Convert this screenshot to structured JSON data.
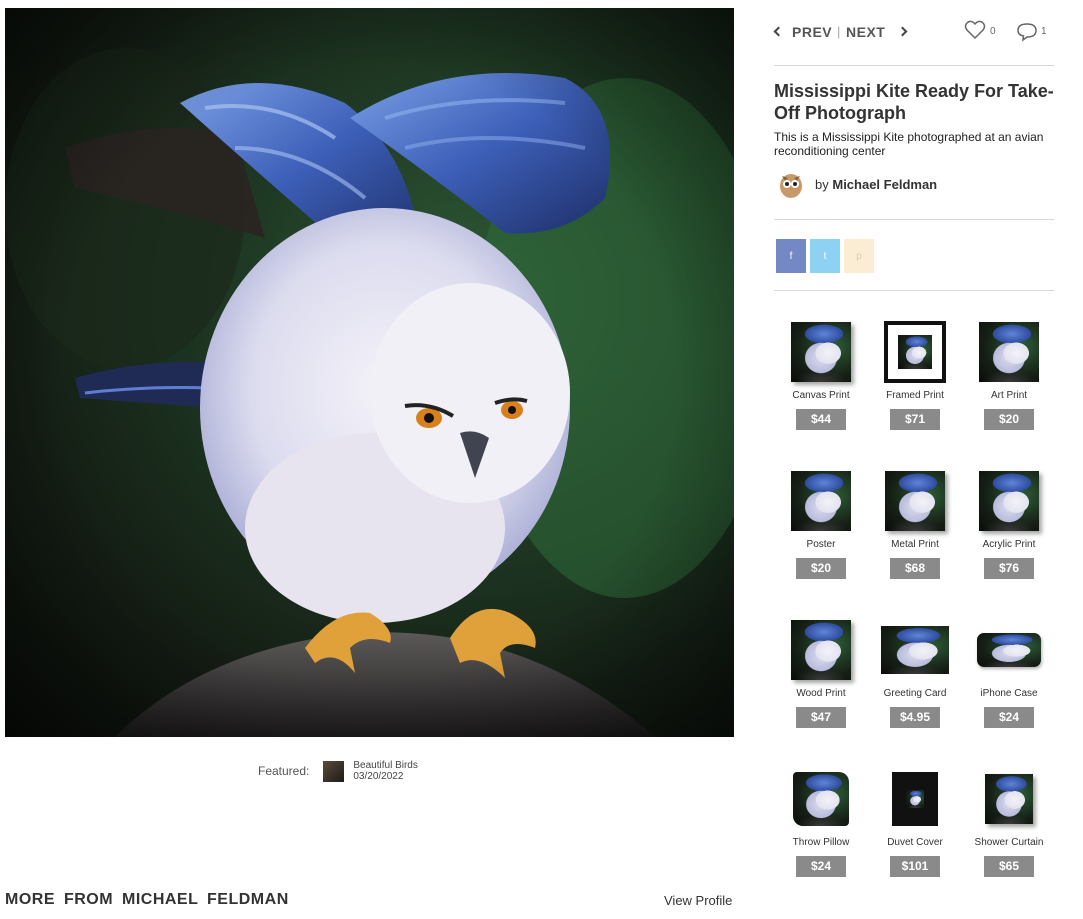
{
  "nav": {
    "prev_label": "PREV",
    "separator": "|",
    "next_label": "NEXT",
    "like_count": "0",
    "comment_count": "1"
  },
  "artwork": {
    "title": "Mississippi Kite Ready For Take-Off Photograph",
    "description": "This is a Mississippi Kite photographed at an avian reconditioning center",
    "artist_prefix": "by",
    "artist_name": "Michael Feldman"
  },
  "share": {
    "facebook": "f",
    "twitter": "t",
    "pinterest": "p"
  },
  "featured": {
    "label": "Featured:",
    "gallery": "Beautiful Birds",
    "date": "03/20/2022"
  },
  "more_from": {
    "heading": "MORE FROM MICHAEL FELDMAN",
    "view_profile": "View Profile"
  },
  "products": [
    {
      "label": "Canvas Print",
      "price": "$44"
    },
    {
      "label": "Framed Print",
      "price": "$71"
    },
    {
      "label": "Art Print",
      "price": "$20"
    },
    {
      "label": "Poster",
      "price": "$20"
    },
    {
      "label": "Metal Print",
      "price": "$68"
    },
    {
      "label": "Acrylic Print",
      "price": "$76"
    },
    {
      "label": "Wood Print",
      "price": "$47"
    },
    {
      "label": "Greeting Card",
      "price": "$4.95"
    },
    {
      "label": "iPhone Case",
      "price": "$24"
    },
    {
      "label": "Throw Pillow",
      "price": "$24"
    },
    {
      "label": "Duvet Cover",
      "price": "$101"
    },
    {
      "label": "Shower Curtain",
      "price": "$65"
    }
  ],
  "colors": {
    "price_badge": "#8a8a8a",
    "facebook": "#7388c4",
    "twitter": "#8dd1f3",
    "pinterest": "#fbecd4"
  }
}
